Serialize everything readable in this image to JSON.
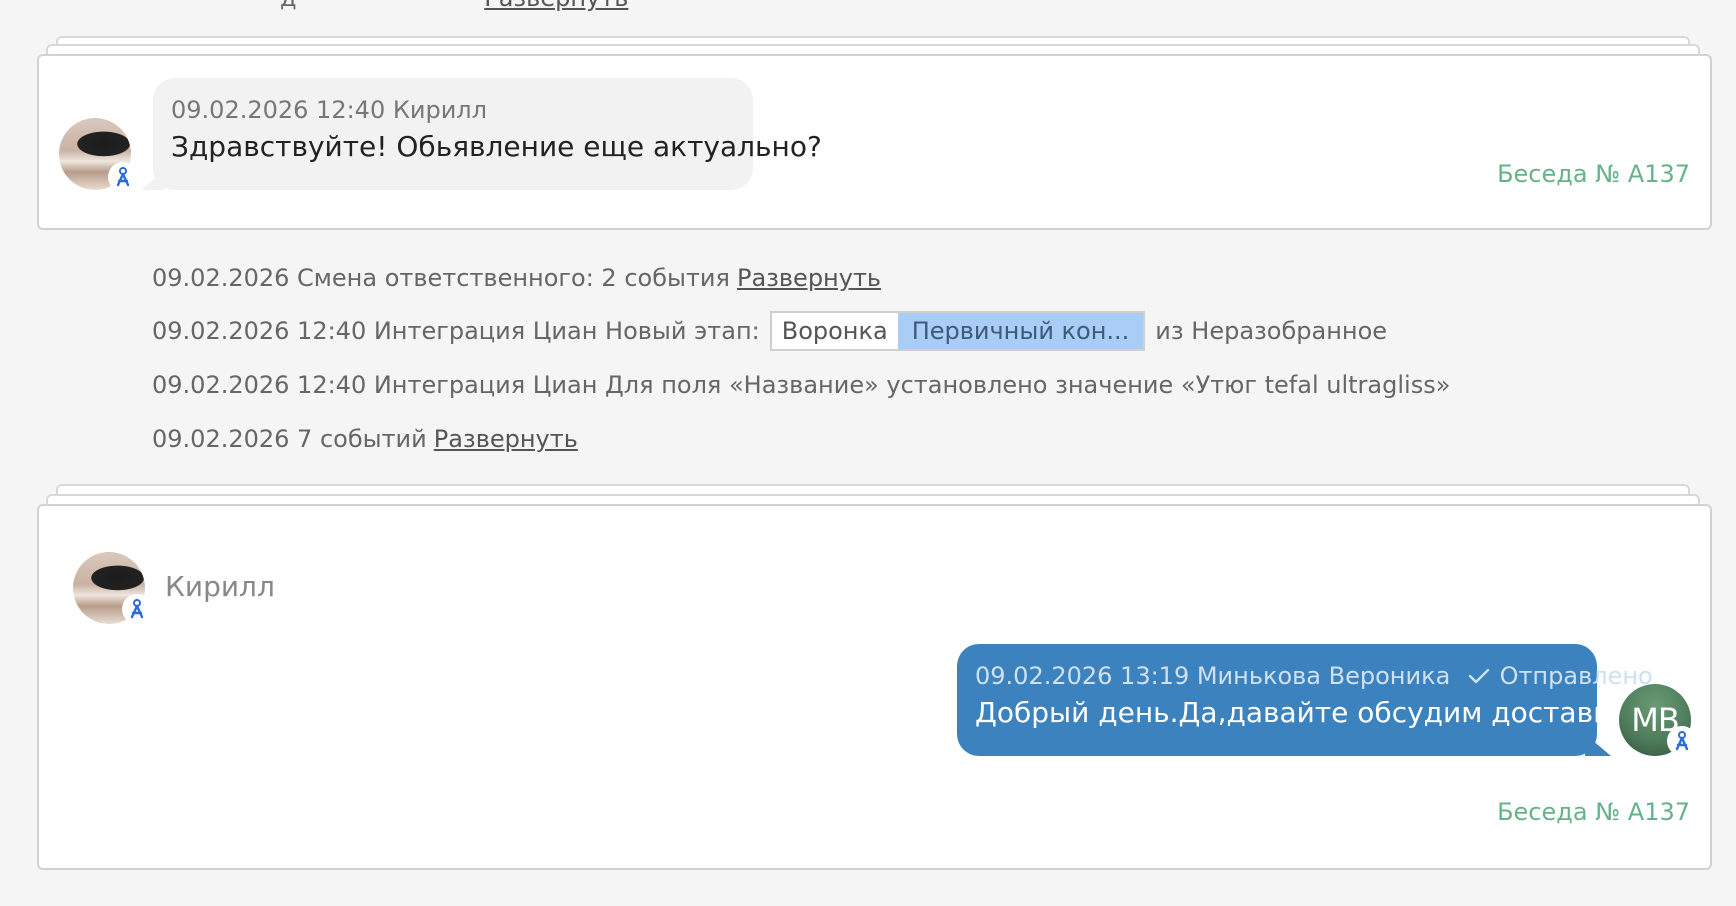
{
  "top_event": {
    "prefix": "д",
    "link": "Развернуть"
  },
  "card1": {
    "meta": "09.02.2026 12:40 Кирилл",
    "text": "Здравствуйте! Обьявление еще актуально?",
    "conversation": "Беседа № A137"
  },
  "events": [
    {
      "text": "09.02.2026 Смена ответственного: 2 события",
      "link": "Развернуть"
    },
    {
      "text": "09.02.2026 12:40 Интеграция Циан Новый этап:",
      "pipeline": "Воронка",
      "stage": "Первичный кон...",
      "suffix": "из Неразобранное"
    },
    {
      "text": "09.02.2026 12:40 Интеграция Циан Для поля «Название» установлено значение «Утюг tefal ultragliss»"
    },
    {
      "text": "09.02.2026 7 событий",
      "link": "Развернуть"
    }
  ],
  "card2": {
    "author": "Кирилл",
    "meta": "09.02.2026 13:19 Минькова Вероника",
    "status": "Отправлено",
    "text": "Добрый день.Да,давайте обсудим доставку .",
    "avatar_initials": "МВ",
    "conversation": "Беседа № A137"
  },
  "colors": {
    "accent_green": "#66b38a",
    "outgoing_bubble": "#3c82be",
    "stage_highlight": "#a9cdf6",
    "channel_badge": "#2f6bd8"
  },
  "icons": {
    "channel": "avito-channel-icon",
    "sent": "check-icon"
  }
}
